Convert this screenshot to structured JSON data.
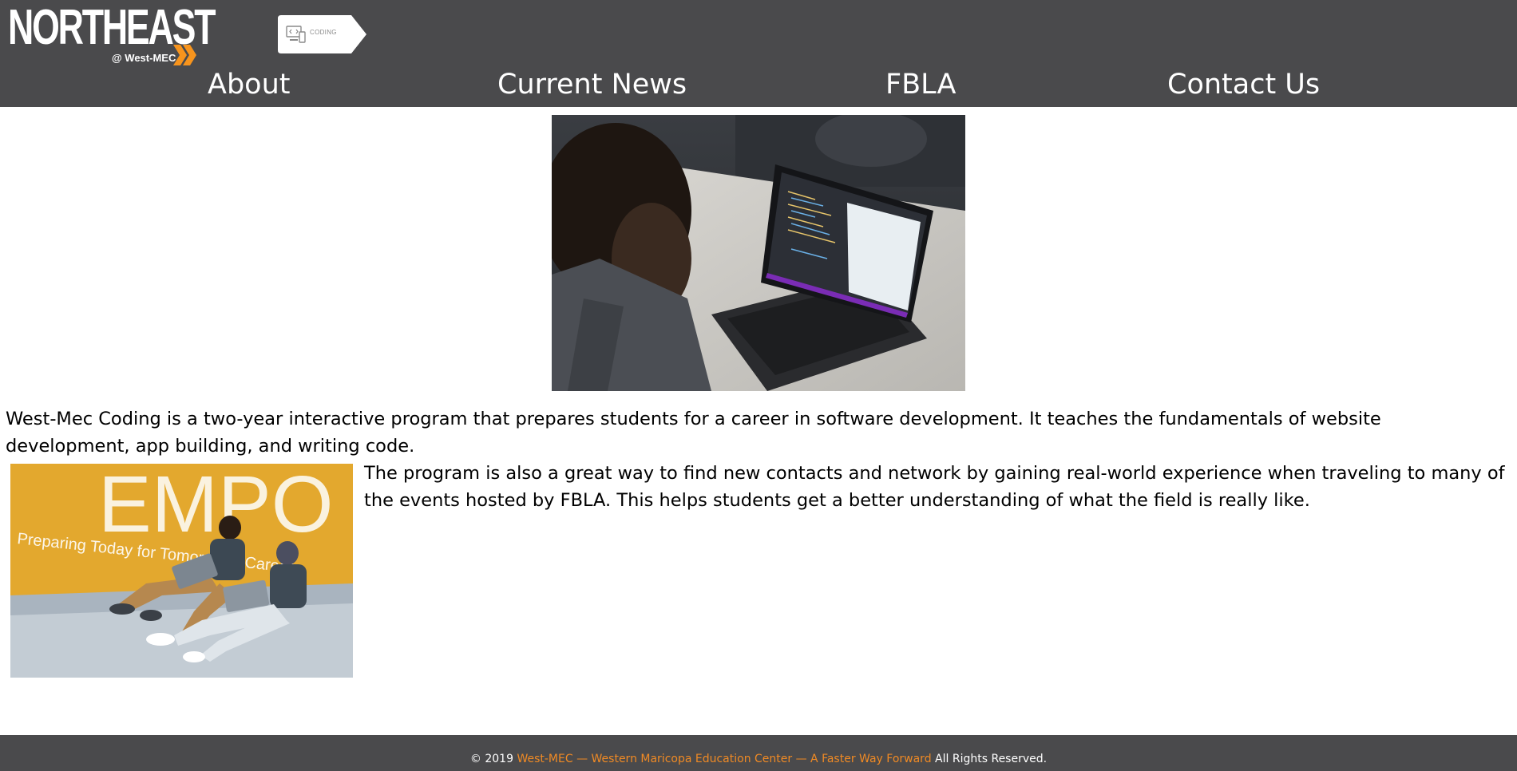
{
  "brand": {
    "logo_text": "NORTHEAST",
    "logo_subtext": "@ West-MEC",
    "program_tag": "CODING",
    "logo_color": "#ffffff",
    "accent_color": "#f7941d"
  },
  "nav": {
    "items": [
      {
        "label": "About"
      },
      {
        "label": "Current News"
      },
      {
        "label": "FBLA"
      },
      {
        "label": "Contact Us"
      }
    ]
  },
  "main": {
    "intro": "West-Mec Coding is a two-year interactive program that prepares students for a career in software development. It teaches the fundamentals of website development, app building, and writing code.",
    "program": "The program is also a great way to find new contacts and network by gaining real-world experience when traveling to many of the events hosted by FBLA. This helps students get a better understanding of what the field is really like.",
    "side_image_text": {
      "wall_letters": "EMPO",
      "wall_slogan": "Preparing Today for Tomorrow's Careers"
    }
  },
  "footer": {
    "copyright": "© 2019",
    "org_link": "West-MEC — Western Maricopa Education Center — A Faster Way Forward",
    "rights": "All Rights Reserved.",
    "link_color": "#f08a24"
  },
  "colors": {
    "header_bg": "#4a4a4c",
    "footer_bg": "#4a4a4c",
    "page_bg": "#ffffff"
  }
}
